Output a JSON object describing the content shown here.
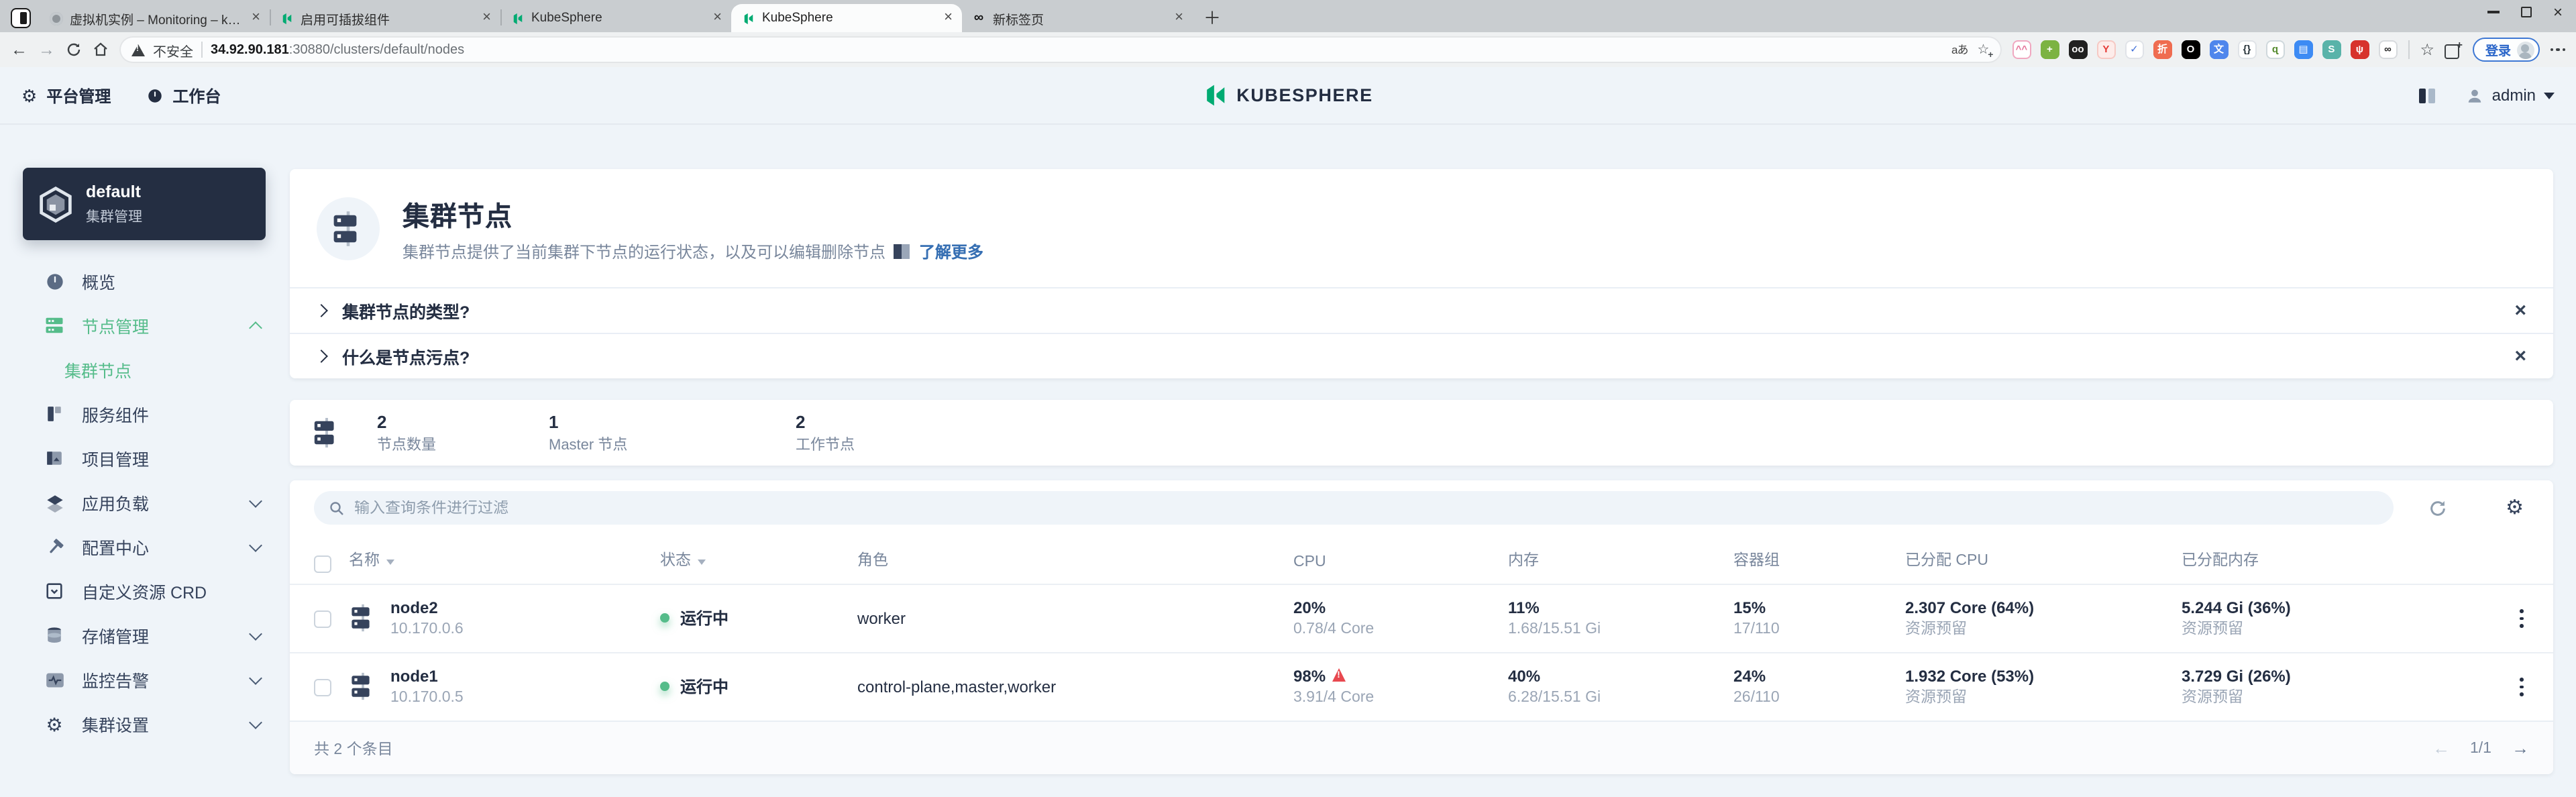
{
  "browser": {
    "tabs": [
      {
        "label": "虚拟机实例 – Monitoring – kube…",
        "icon": "gray-circle",
        "active": false
      },
      {
        "label": "启用可插拔组件",
        "icon": "kubesphere",
        "active": false
      },
      {
        "label": "KubeSphere",
        "icon": "kubesphere",
        "active": false
      },
      {
        "label": "KubeSphere",
        "icon": "kubesphere",
        "active": true
      },
      {
        "label": "新标签页",
        "icon": "infinity",
        "active": false
      }
    ],
    "toolbar": {
      "security_label": "不安全",
      "url_host": "34.92.90.181",
      "url_rest": ":30880/clusters/default/nodes",
      "translate_label": "aあ",
      "login_label": "登录"
    },
    "extensions": [
      {
        "name": "cat-extension-icon",
        "glyph": "^^",
        "fg": "#e57399",
        "bg": "#ffffff",
        "border": "#f0a8c0"
      },
      {
        "name": "health-extension-icon",
        "glyph": "+",
        "fg": "#ffffff",
        "bg": "#7cb342",
        "border": "#7cb342"
      },
      {
        "name": "eyes-extension-icon",
        "glyph": "oo",
        "fg": "#ffffff",
        "bg": "#212121",
        "border": "#212121"
      },
      {
        "name": "red-figure-extension-icon",
        "glyph": "Y",
        "fg": "#e53935",
        "bg": "#fdecea",
        "border": "#f6c9c4"
      },
      {
        "name": "check-extension-icon",
        "glyph": "✓",
        "fg": "#3f6fd8",
        "bg": "#ffffff",
        "border": "#e0e3e8"
      },
      {
        "name": "zhe-extension-icon",
        "glyph": "折",
        "fg": "#ffffff",
        "bg": "#ef6c50",
        "border": "#ef6c50"
      },
      {
        "name": "ring-extension-icon",
        "glyph": "O",
        "fg": "#ffffff",
        "bg": "#000000",
        "border": "#000000"
      },
      {
        "name": "translate-extension-icon",
        "glyph": "文",
        "fg": "#ffffff",
        "bg": "#4f86ec",
        "border": "#4f86ec"
      },
      {
        "name": "braces-extension-icon",
        "glyph": "{}",
        "fg": "#263238",
        "bg": "#ffffff",
        "border": "#dfe3e7"
      },
      {
        "name": "person-extension-icon",
        "glyph": "ɋ",
        "fg": "#558b2f",
        "bg": "#ffffff",
        "border": "#cfd8dc"
      },
      {
        "name": "docs-extension-icon",
        "glyph": "▤",
        "fg": "#ffffff",
        "bg": "#3d8bf4",
        "border": "#3d8bf4"
      },
      {
        "name": "s-extension-icon",
        "glyph": "S",
        "fg": "#ffffff",
        "bg": "#59b3a9",
        "border": "#59b3a9"
      },
      {
        "name": "hand-extension-icon",
        "glyph": "ψ",
        "fg": "#ffffff",
        "bg": "#d7332c",
        "border": "#d7332c"
      },
      {
        "name": "infinity-extension-icon",
        "glyph": "∞",
        "fg": "#212121",
        "bg": "#ffffff",
        "border": "#d7dadd"
      }
    ]
  },
  "header": {
    "nav": [
      {
        "label": "平台管理"
      },
      {
        "label": "工作台"
      }
    ],
    "logo_text": "KUBESPHERE",
    "user": "admin"
  },
  "sidebar": {
    "cluster": {
      "name": "default",
      "subtitle": "集群管理"
    },
    "items": [
      {
        "label": "概览"
      },
      {
        "label": "节点管理",
        "active": true,
        "expanded": true
      },
      {
        "label": "集群节点",
        "child": true,
        "active": true
      },
      {
        "label": "服务组件"
      },
      {
        "label": "项目管理"
      },
      {
        "label": "应用负载",
        "collapsible": true
      },
      {
        "label": "配置中心",
        "collapsible": true
      },
      {
        "label": "自定义资源 CRD"
      },
      {
        "label": "存储管理",
        "collapsible": true
      },
      {
        "label": "监控告警",
        "collapsible": true
      },
      {
        "label": "集群设置",
        "collapsible": true
      }
    ]
  },
  "page": {
    "title": "集群节点",
    "description": "集群节点提供了当前集群下节点的运行状态，以及可以编辑删除节点",
    "learn_more": "了解更多",
    "faqs": [
      "集群节点的类型?",
      "什么是节点污点?"
    ],
    "stats": [
      {
        "value": "2",
        "label": "节点数量"
      },
      {
        "value": "1",
        "label": "Master 节点"
      },
      {
        "value": "2",
        "label": "工作节点"
      }
    ],
    "search_placeholder": "输入查询条件进行过滤",
    "table": {
      "columns": [
        "名称",
        "状态",
        "角色",
        "CPU",
        "内存",
        "容器组",
        "已分配 CPU",
        "已分配内存"
      ],
      "rows": [
        {
          "name": "node2",
          "ip": "10.170.0.6",
          "status": "运行中",
          "role": "worker",
          "cpu_pct": "20%",
          "cpu_detail": "0.78/4 Core",
          "mem_pct": "11%",
          "mem_detail": "1.68/15.51 Gi",
          "pods_pct": "15%",
          "pods_detail": "17/110",
          "alloc_cpu": "2.307 Core (64%)",
          "alloc_cpu_sub": "资源预留",
          "alloc_mem": "5.244 Gi (36%)",
          "alloc_mem_sub": "资源预留",
          "warning": false
        },
        {
          "name": "node1",
          "ip": "10.170.0.5",
          "status": "运行中",
          "role": "control-plane,master,worker",
          "cpu_pct": "98%",
          "cpu_detail": "3.91/4 Core",
          "mem_pct": "40%",
          "mem_detail": "6.28/15.51 Gi",
          "pods_pct": "24%",
          "pods_detail": "26/110",
          "alloc_cpu": "1.932 Core (53%)",
          "alloc_cpu_sub": "资源预留",
          "alloc_mem": "3.729 Gi (26%)",
          "alloc_mem_sub": "资源预留",
          "warning": true
        }
      ],
      "total": "共 2 个条目",
      "pagination": "1/1"
    }
  },
  "colors": {
    "accent_green": "#55bc8a",
    "logo_green": "#00ab72",
    "dark": "#242e42",
    "secondary_text": "#79879c",
    "page_bg": "#eff4f9",
    "warning_red": "#e8484f",
    "link_blue": "#366fb3"
  }
}
